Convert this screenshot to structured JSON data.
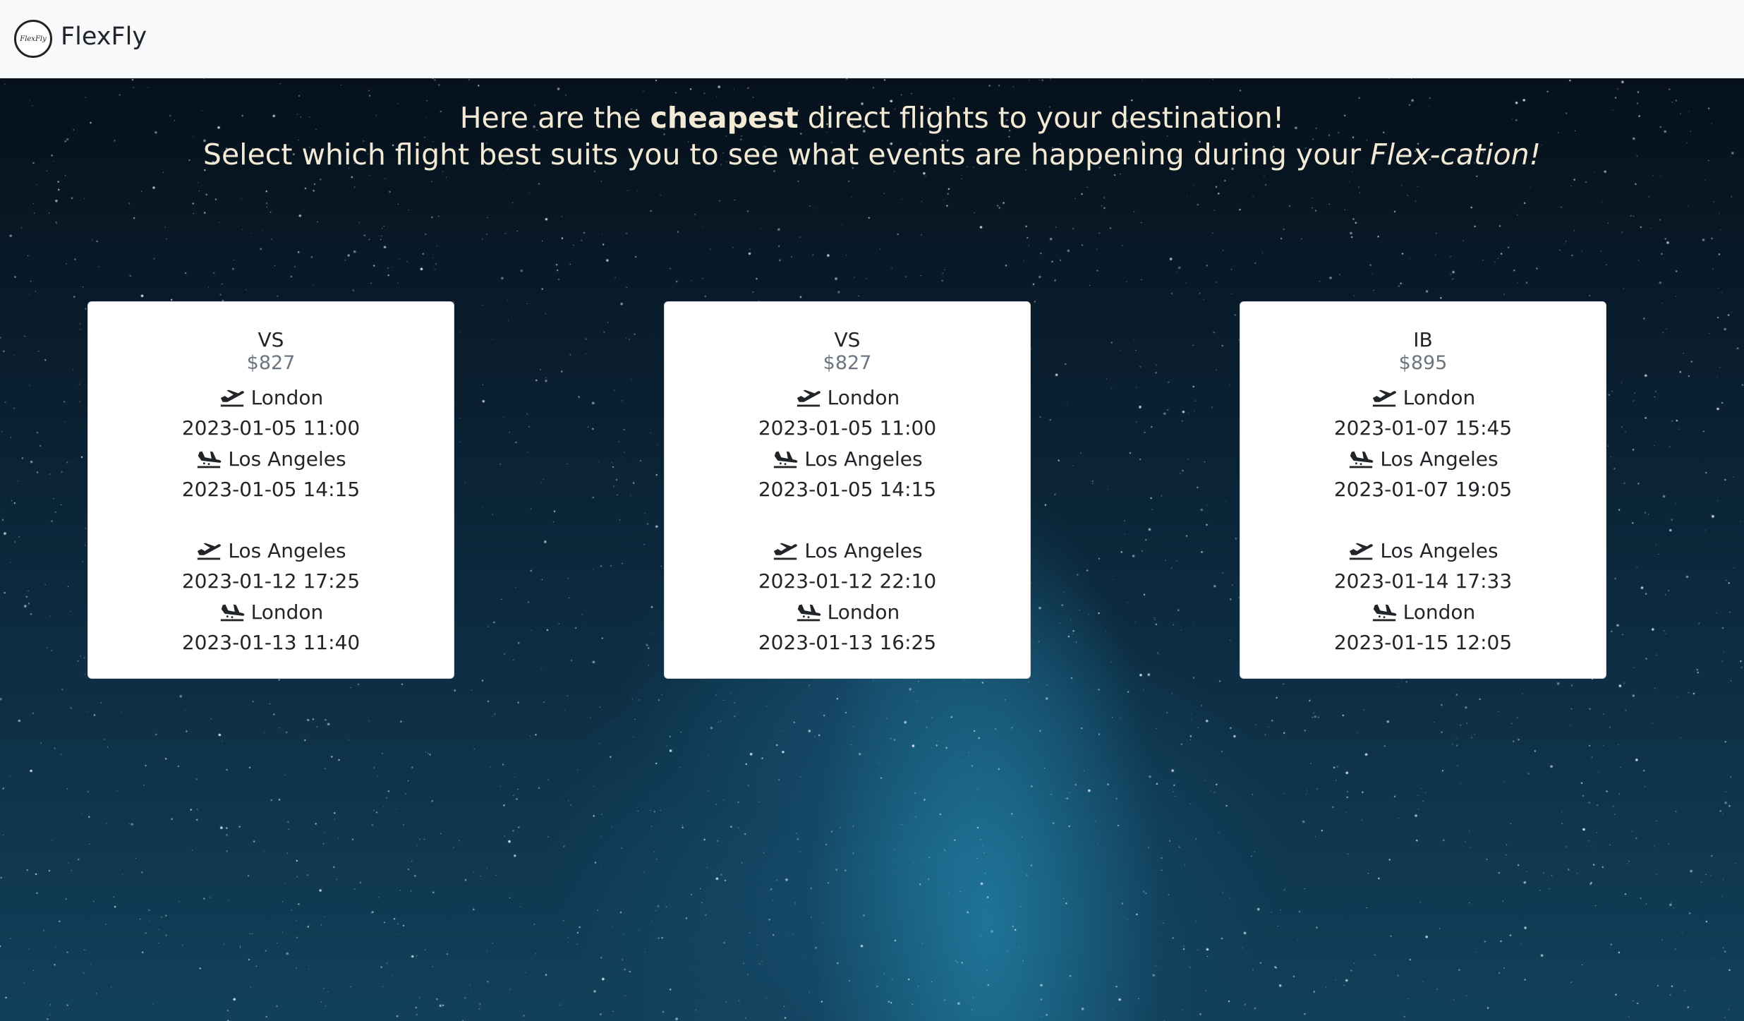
{
  "app": {
    "brand": "FlexFly",
    "logo_text": "FlexFly"
  },
  "headline": {
    "line1_pre": "Here are the ",
    "line1_bold": "cheapest",
    "line1_post": " direct flights to your destination!",
    "line2_pre": "Select which flight best suits you to see what events are happening during your ",
    "line2_italic": "Flex-cation!"
  },
  "icons": {
    "departure": "plane-departure-icon",
    "arrival": "plane-arrival-icon"
  },
  "flights": [
    {
      "airline": "VS",
      "price": "$827",
      "outbound": {
        "from": "London",
        "depart_time": "2023-01-05 11:00",
        "to": "Los Angeles",
        "arrive_time": "2023-01-05 14:15"
      },
      "return": {
        "from": "Los Angeles",
        "depart_time": "2023-01-12 17:25",
        "to": "London",
        "arrive_time": "2023-01-13 11:40"
      }
    },
    {
      "airline": "VS",
      "price": "$827",
      "outbound": {
        "from": "London",
        "depart_time": "2023-01-05 11:00",
        "to": "Los Angeles",
        "arrive_time": "2023-01-05 14:15"
      },
      "return": {
        "from": "Los Angeles",
        "depart_time": "2023-01-12 22:10",
        "to": "London",
        "arrive_time": "2023-01-13 16:25"
      }
    },
    {
      "airline": "IB",
      "price": "$895",
      "outbound": {
        "from": "London",
        "depart_time": "2023-01-07 15:45",
        "to": "Los Angeles",
        "arrive_time": "2023-01-07 19:05"
      },
      "return": {
        "from": "Los Angeles",
        "depart_time": "2023-01-14 17:33",
        "to": "London",
        "arrive_time": "2023-01-15 12:05"
      }
    }
  ]
}
